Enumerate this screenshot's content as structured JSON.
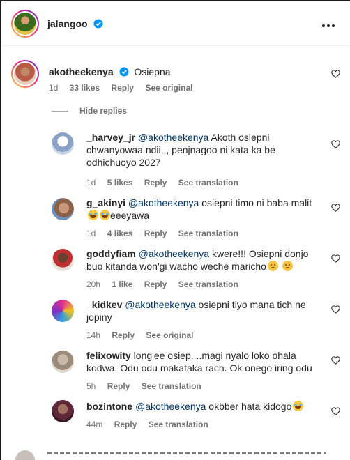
{
  "header": {
    "username": "jalangoo",
    "avatar_color": "#4a7a2a"
  },
  "main_comment": {
    "username": "akotheekenya",
    "text": "Osiepna",
    "time": "1d",
    "likes": "33 likes",
    "reply_label": "Reply",
    "extra_label": "See original"
  },
  "hide_replies_label": "Hide replies",
  "replies": [
    {
      "username": "_harvey_jr",
      "mention": "@akotheekenya",
      "text_line1": " Akoth osiepni",
      "text_line2": "chwanyowaa ndii,,, penjnagoo ni kata ka be",
      "text_line3": "odhichuoyo 2027",
      "time": "1d",
      "likes": "5 likes",
      "reply_label": "Reply",
      "extra_label": "See translation"
    },
    {
      "username": "g_akinyi",
      "mention": "@akotheekenya",
      "text_line1": " osiepni timo ni baba malit",
      "text_line2": "eeeyawa",
      "time": "1d",
      "likes": "4 likes",
      "reply_label": "Reply",
      "extra_label": "See translation"
    },
    {
      "username": "goddyfiam",
      "mention": "@akotheekenya",
      "text_line1": " kwere!!! Osiepni donjo",
      "text_line2": "buo kitanda won'gi wacho weche maricho",
      "time": "20h",
      "likes": "1 like",
      "reply_label": "Reply",
      "extra_label": "See translation"
    },
    {
      "username": "_kidkev",
      "mention": "@akotheekenya",
      "text_line1": " osiepni tiyo mana tich ne",
      "text_line2": "jopiny",
      "time": "14h",
      "reply_label": "Reply",
      "extra_label": "See original"
    },
    {
      "username": "felixowity",
      "text_line1": " long'ee osiep....magi nyalo loko ohala",
      "text_line2": "kodwa. Odu odu makataka rach. Ok onego iring odu",
      "time": "5h",
      "reply_label": "Reply",
      "extra_label": "See translation"
    },
    {
      "username": "bozintone",
      "mention": "@akotheekenya",
      "text_line1": " okbber hata kidogo",
      "time": "44m",
      "reply_label": "Reply",
      "extra_label": "See translation"
    }
  ],
  "colors": {
    "mention": "#00376b",
    "meta": "#737373",
    "verified": "#0095f6"
  }
}
